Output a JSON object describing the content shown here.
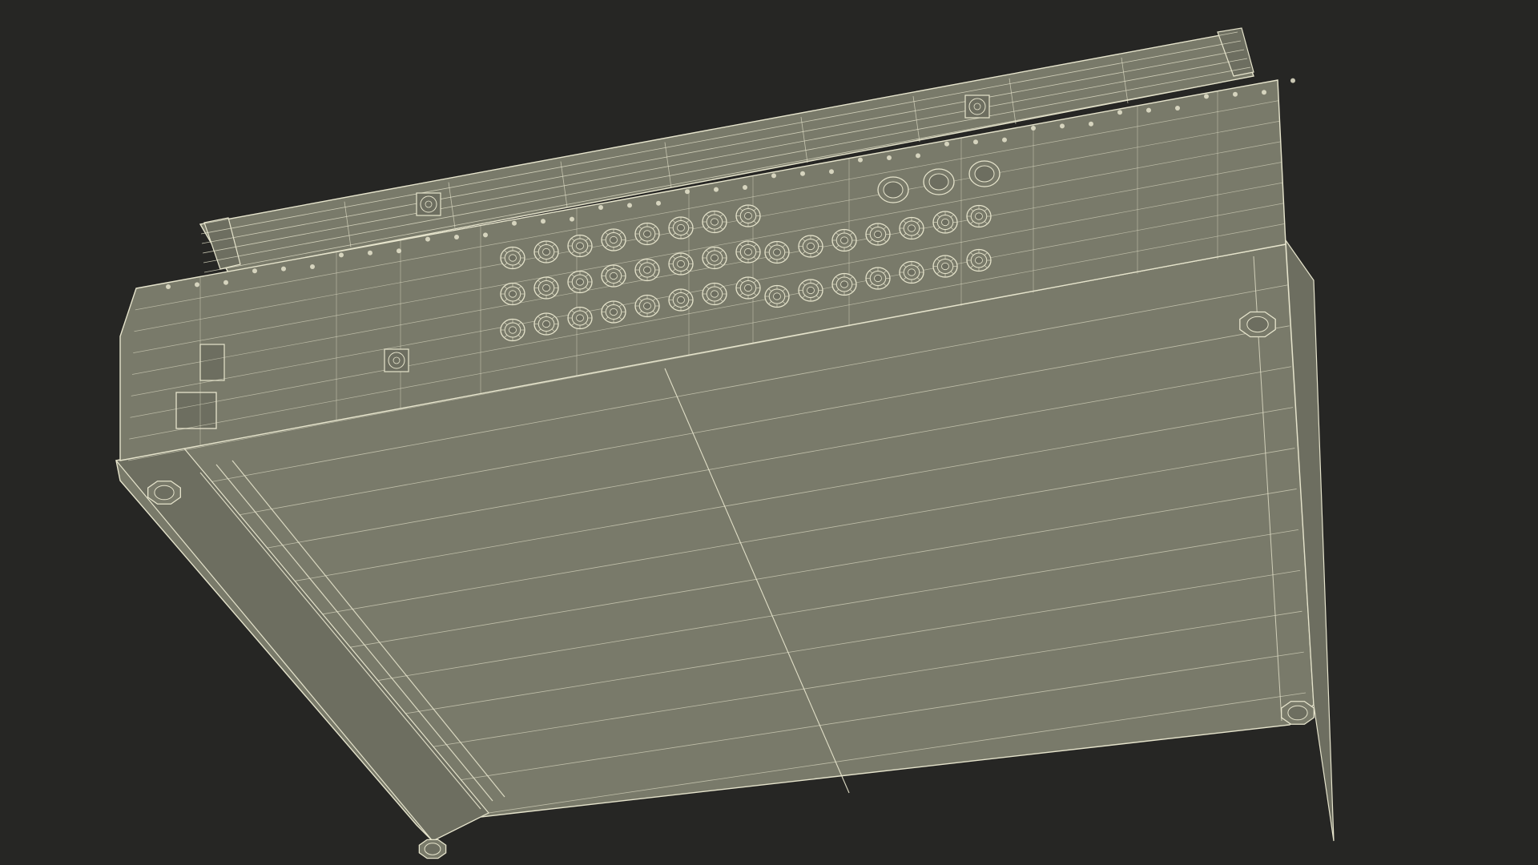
{
  "scene": {
    "background": "#262624",
    "fill": "#797a6a",
    "fill_dark": "#6d6e60",
    "wire": "#e6e4cc",
    "wire_dim": "#cfcdb4"
  },
  "model": {
    "input_jack_rows": 3,
    "input_jacks_per_row": 8,
    "output_jack_rows": 2,
    "output_jacks_per_row": 7,
    "xlr_outputs": 3,
    "feet": 4,
    "cooling_fans": 3
  }
}
